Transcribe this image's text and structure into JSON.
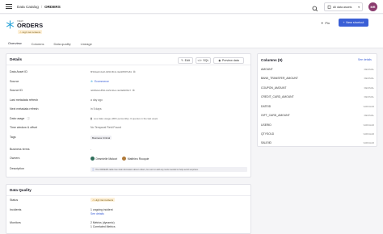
{
  "topbar": {
    "breadcrumb_root": "Data Catalog",
    "breadcrumb_sep": "/",
    "breadcrumb_current": "ORDERS",
    "account_label": "All data assets",
    "avatar_initials": "MR"
  },
  "header": {
    "asset_kind": "VIEW",
    "asset_title": "ORDERS",
    "risk_chip": "High risk incidents",
    "pin_label": "Pin",
    "new_shortcut_label": "New shortcut"
  },
  "tabs": [
    "Overview",
    "Columns",
    "Data quality",
    "Lineage"
  ],
  "details": {
    "title": "Details",
    "edit_label": "Edit",
    "sql_label": "SQL",
    "preview_label": "Preview data",
    "rows": {
      "data_asset_id": {
        "label": "Data Asset ID",
        "value": "8f3b4a22-0a1f-4b60-8b4c-3ad28b5f7a81"
      },
      "source": {
        "label": "Source",
        "value": "Ecommerce"
      },
      "source_id": {
        "label": "Source ID",
        "value": "4d0f62a4-8f5d-4c29-b0e1-4e0fa9b8f2c7"
      },
      "last_refresh": {
        "label": "Last metadata refresh",
        "value": "a day ago"
      },
      "next_refresh": {
        "label": "Next metadata refresh",
        "value": "in 5 days"
      },
      "data_usage": {
        "label": "Data usage",
        "value": "Low data usage (30th percentile). 0 queries in the last week"
      },
      "time_window": {
        "label": "Time window & offset",
        "value": "No Temporal Field Found"
      },
      "tags": {
        "label": "Tags",
        "value": "Business Critical"
      },
      "business_terms": {
        "label": "Business terms",
        "value": "-"
      },
      "owners": {
        "label": "Owners",
        "value_1": "Desmielle Malcori",
        "value_2": "Matthieu Rouquie"
      },
      "description": {
        "label": "Description",
        "value": "The ORDERS table has vital information about orders, be sure to add any tests needed to help avoid surprises."
      }
    }
  },
  "data_quality": {
    "title": "Data Quality",
    "rows": {
      "status": {
        "label": "Status",
        "value": "High risk incidents"
      },
      "incidents": {
        "label": "Incidents",
        "value": "1 ongoing incident",
        "link": "See details"
      },
      "monitors": {
        "label": "Monitors",
        "value": "2 Metrics (dynamic)",
        "value_2": "1 Correlated Metrics"
      }
    }
  },
  "columns": {
    "title": "Columns (9)",
    "see_details": "See details",
    "items": [
      {
        "name": "AMOUNT",
        "type": "DECIMAL"
      },
      {
        "name": "BANK_TRANSFER_AMOUNT",
        "type": "DECIMAL"
      },
      {
        "name": "COUPON_AMOUNT",
        "type": "DECIMAL"
      },
      {
        "name": "CREDIT_CARD_AMOUNT",
        "type": "DECIMAL"
      },
      {
        "name": "DATEID",
        "type": "VARCHAR"
      },
      {
        "name": "GIFT_CARD_AMOUNT",
        "type": "DECIMAL"
      },
      {
        "name": "USERID",
        "type": "VARCHAR"
      },
      {
        "name": "QTYSOLD",
        "type": "VARCHAR"
      },
      {
        "name": "SALEIID",
        "type": "VARCHAR"
      }
    ]
  },
  "colors": {
    "accent": "#3a5fd6",
    "avatar": "#8a3b6e",
    "risk_bg": "#fdf0d8"
  }
}
